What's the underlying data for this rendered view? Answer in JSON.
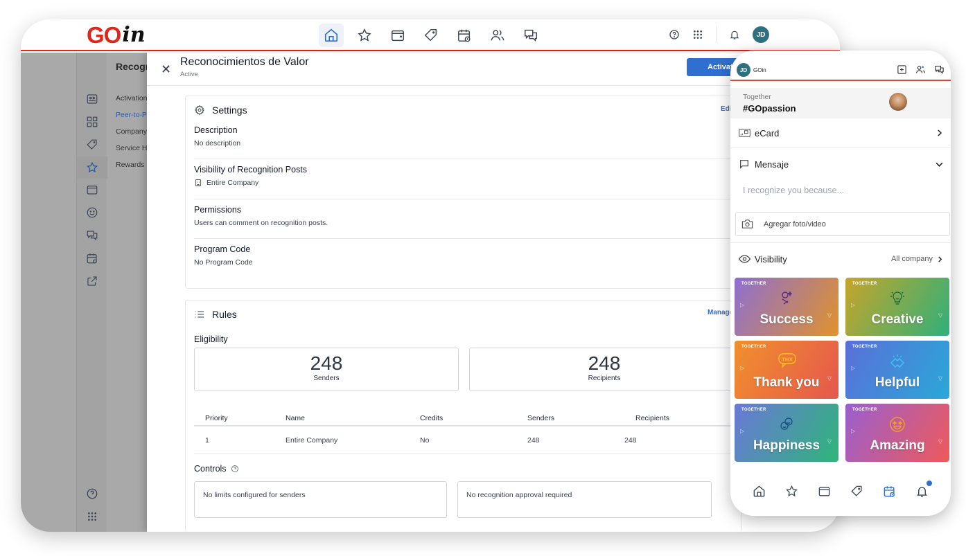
{
  "brand": {
    "logo_go": "GO",
    "logo_in": "in",
    "accent": "#e1251b",
    "primary": "#2f6fd0"
  },
  "topnav": {
    "items": [
      {
        "icon": "home-icon",
        "active": true
      },
      {
        "icon": "star-icon",
        "active": false
      },
      {
        "icon": "wallet-icon",
        "active": false
      },
      {
        "icon": "tag-icon",
        "active": false
      },
      {
        "icon": "calendar-clock-icon",
        "active": false
      },
      {
        "icon": "users-icon",
        "active": false
      },
      {
        "icon": "chat-icon",
        "active": false
      }
    ],
    "right": {
      "help": "help-icon",
      "apps": "grid-icon",
      "bell": "bell-icon",
      "avatar_initials": "JD"
    }
  },
  "background_app": {
    "logo_badge": "GO",
    "title": "Recogn",
    "subnav": [
      "Activation",
      "Peer-to-P",
      "Company",
      "Service H",
      "Rewards"
    ],
    "subnav_active_index": 1,
    "rail_icons": [
      "team-board-icon",
      "dashboard-icon",
      "tag-icon",
      "star-icon",
      "wallet-icon",
      "smile-icon",
      "chat-icon",
      "calendar-clock-icon",
      "external-link-icon"
    ],
    "rail_bottom": [
      "help-icon",
      "grid-icon"
    ]
  },
  "panel": {
    "title": "Reconocimientos de Valor",
    "status": "Active",
    "activate_label": "Activate",
    "settings": {
      "heading": "Settings",
      "edit_label": "Edit",
      "sections": [
        {
          "label": "Description",
          "value": "No description"
        },
        {
          "label": "Visibility of Recognition Posts",
          "value": "Entire Company"
        },
        {
          "label": "Permissions",
          "value": "Users can comment on recognition posts."
        },
        {
          "label": "Program Code",
          "value": "No Program Code"
        }
      ]
    },
    "rules": {
      "heading": "Rules",
      "manage_label": "Manage",
      "eligibility_label": "Eligibility",
      "senders_count": "248",
      "senders_label": "Senders",
      "recipients_count": "248",
      "recipients_label": "Recipients",
      "table": {
        "headers": [
          "Priority",
          "Name",
          "Credits",
          "Senders",
          "Recipients"
        ],
        "rows": [
          [
            "1",
            "Entire Company",
            "No",
            "248",
            "248"
          ]
        ]
      },
      "controls_label": "Controls",
      "controls": [
        "No limits configured for senders",
        "No recognition approval required"
      ]
    }
  },
  "phone": {
    "avatar_initials": "JD",
    "app_name": "GOin",
    "together_label": "Together",
    "hashtag": "#GOpassion",
    "ecard_label": "eCard",
    "mensaje_label": "Mensaje",
    "message_placeholder": "I recognize you because...",
    "add_photo_label": "Agregar foto/video",
    "visibility_label": "Visibility",
    "visibility_value": "All company",
    "ecards": [
      {
        "tag": "TOGETHER",
        "name": "Success",
        "from": "#8e6fd1",
        "to": "#e0922b"
      },
      {
        "tag": "TOGETHER",
        "name": "Creative",
        "from": "#c6a52a",
        "to": "#2fb07a"
      },
      {
        "tag": "TOGETHER",
        "name": "Thank you",
        "from": "#f0902c",
        "to": "#e5574d"
      },
      {
        "tag": "TOGETHER",
        "name": "Helpful",
        "from": "#5a6fd9",
        "to": "#2aa8d8"
      },
      {
        "tag": "TOGETHER",
        "name": "Happiness",
        "from": "#6a78d8",
        "to": "#2fb57a"
      },
      {
        "tag": "TOGETHER",
        "name": "Amazing",
        "from": "#9a5fd0",
        "to": "#ee5a5a"
      }
    ],
    "bottom_nav": [
      "home-icon",
      "star-icon",
      "wallet-icon",
      "tag-icon",
      "calendar-clock-icon",
      "bell-icon"
    ],
    "bottom_nav_active_index": 4
  }
}
